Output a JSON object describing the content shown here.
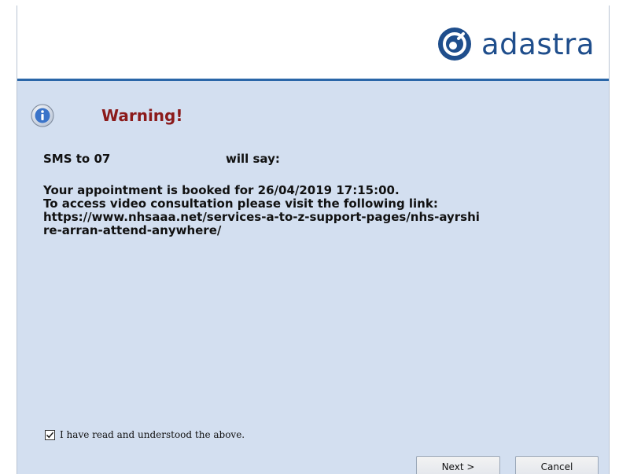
{
  "header": {
    "logo_text": "adastra",
    "logo_icon": "adastra-logo-icon"
  },
  "dialog": {
    "icon": "info-icon",
    "title": "Warning!",
    "sms_to": "SMS to 07",
    "will_say": "will say:",
    "message_lines": [
      "Your appointment is booked for 26/04/2019 17:15:00.",
      "To access video consultation please visit the following link:",
      "https://www.nhsaaa.net/services-a-to-z-support-pages/nhs-ayrshi",
      "re-arran-attend-anywhere/"
    ],
    "acknowledge": {
      "label": "I have read and understood the above.",
      "checked": true
    }
  },
  "buttons": {
    "next": "Next >",
    "cancel": "Cancel"
  },
  "colors": {
    "header_rule": "#2a66a8",
    "content_bg": "#d3dff0",
    "warning_title": "#8b1a1a",
    "logo": "#1f4e8c"
  }
}
